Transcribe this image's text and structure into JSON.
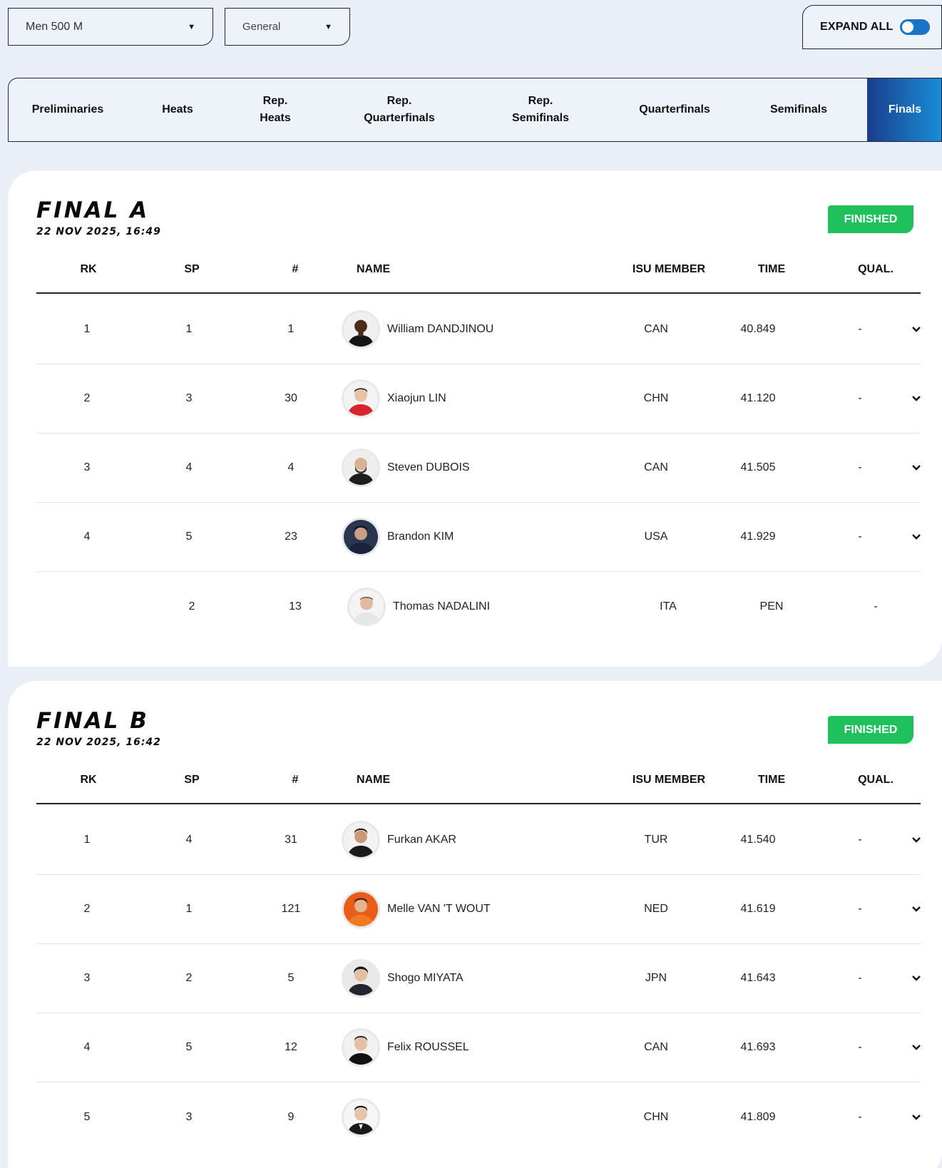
{
  "filters": {
    "event": "Men 500 M",
    "category": "General"
  },
  "expand_all": {
    "label": "EXPAND ALL",
    "enabled": true
  },
  "round_tabs": [
    {
      "line1": "Preliminaries",
      "line2": ""
    },
    {
      "line1": "Heats",
      "line2": ""
    },
    {
      "line1": "Rep.",
      "line2": "Heats"
    },
    {
      "line1": "Rep.",
      "line2": "Quarterfinals"
    },
    {
      "line1": "Rep.",
      "line2": "Semifinals"
    },
    {
      "line1": "Quarterfinals",
      "line2": ""
    },
    {
      "line1": "Semifinals",
      "line2": ""
    },
    {
      "line1": "Finals",
      "line2": ""
    }
  ],
  "active_tab": "Finals",
  "columns": {
    "rk": "RK",
    "sp": "SP",
    "num": "#",
    "name": "NAME",
    "isu": "ISU MEMBER",
    "time": "TIME",
    "qual": "QUAL."
  },
  "races": [
    {
      "title": "FINAL A",
      "date": "22 NOV 2025, 16:49",
      "status": "FINISHED",
      "rows": [
        {
          "rk": "1",
          "sp": "1",
          "num": "1",
          "name": "William DANDJINOU",
          "isu": "CAN",
          "time": "40.849",
          "qual": "-"
        },
        {
          "rk": "2",
          "sp": "3",
          "num": "30",
          "name": "Xiaojun LIN",
          "isu": "CHN",
          "time": "41.120",
          "qual": "-"
        },
        {
          "rk": "3",
          "sp": "4",
          "num": "4",
          "name": "Steven DUBOIS",
          "isu": "CAN",
          "time": "41.505",
          "qual": "-"
        },
        {
          "rk": "4",
          "sp": "5",
          "num": "23",
          "name": "Brandon KIM",
          "isu": "USA",
          "time": "41.929",
          "qual": "-"
        },
        {
          "rk": "",
          "sp": "2",
          "num": "13",
          "name": "Thomas NADALINI",
          "isu": "ITA",
          "time": "PEN",
          "qual": "-"
        }
      ]
    },
    {
      "title": "FINAL B",
      "date": "22 NOV 2025, 16:42",
      "status": "FINISHED",
      "rows": [
        {
          "rk": "1",
          "sp": "4",
          "num": "31",
          "name": "Furkan AKAR",
          "isu": "TUR",
          "time": "41.540",
          "qual": "-"
        },
        {
          "rk": "2",
          "sp": "1",
          "num": "121",
          "name": "Melle VAN 'T WOUT",
          "isu": "NED",
          "time": "41.619",
          "qual": "-"
        },
        {
          "rk": "3",
          "sp": "2",
          "num": "5",
          "name": "Shogo MIYATA",
          "isu": "JPN",
          "time": "41.643",
          "qual": "-"
        },
        {
          "rk": "4",
          "sp": "5",
          "num": "12",
          "name": "Felix ROUSSEL",
          "isu": "CAN",
          "time": "41.693",
          "qual": "-"
        },
        {
          "rk": "5",
          "sp": "3",
          "num": "9",
          "name": "",
          "isu": "CHN",
          "time": "41.809",
          "qual": "-"
        }
      ]
    }
  ],
  "colors": {
    "page_bg": "#e9eef7",
    "card_bg": "#ffffff",
    "finished_badge": "#1fc15c",
    "tab_active_from": "#1a3d8c",
    "tab_active_to": "#1a8fd8",
    "toggle_on": "#1a73c9"
  }
}
